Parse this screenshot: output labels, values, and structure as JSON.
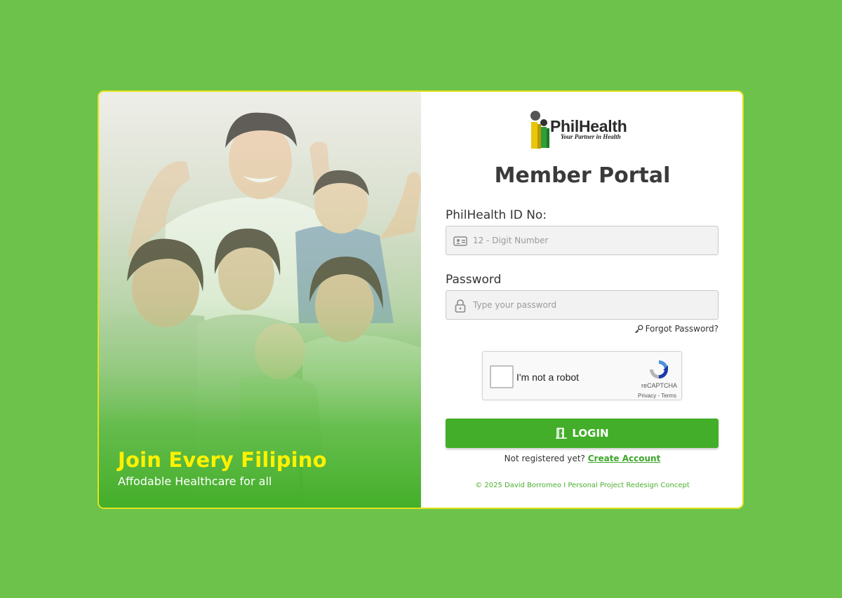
{
  "hero": {
    "title": "Join Every Filipino",
    "subtitle": "Affodable Healthcare for all"
  },
  "logo": {
    "name": "PhilHealth",
    "tagline": "Your Partner in Health"
  },
  "portal_title": "Member Portal",
  "id_field": {
    "label": "PhilHealth ID No:",
    "placeholder": "12 - Digit Number",
    "icon": "id-card-icon"
  },
  "password_field": {
    "label": "Password",
    "placeholder": "Type your password",
    "icon": "lock-icon"
  },
  "forgot_password": "Forgot Password?",
  "captcha": {
    "label": "I'm not a robot",
    "brand": "reCAPTCHA",
    "links": "Privacy - Terms"
  },
  "login_button": "LOGIN",
  "register": {
    "prompt": "Not registered yet?",
    "link": "Create Account"
  },
  "footer": "© 2025 David Borromeo I Personal Project Redesign Concept",
  "colors": {
    "background": "#6cc24a",
    "accent_green": "#43ae29",
    "hero_title": "#fff200",
    "card_border": "#e2e21f"
  }
}
